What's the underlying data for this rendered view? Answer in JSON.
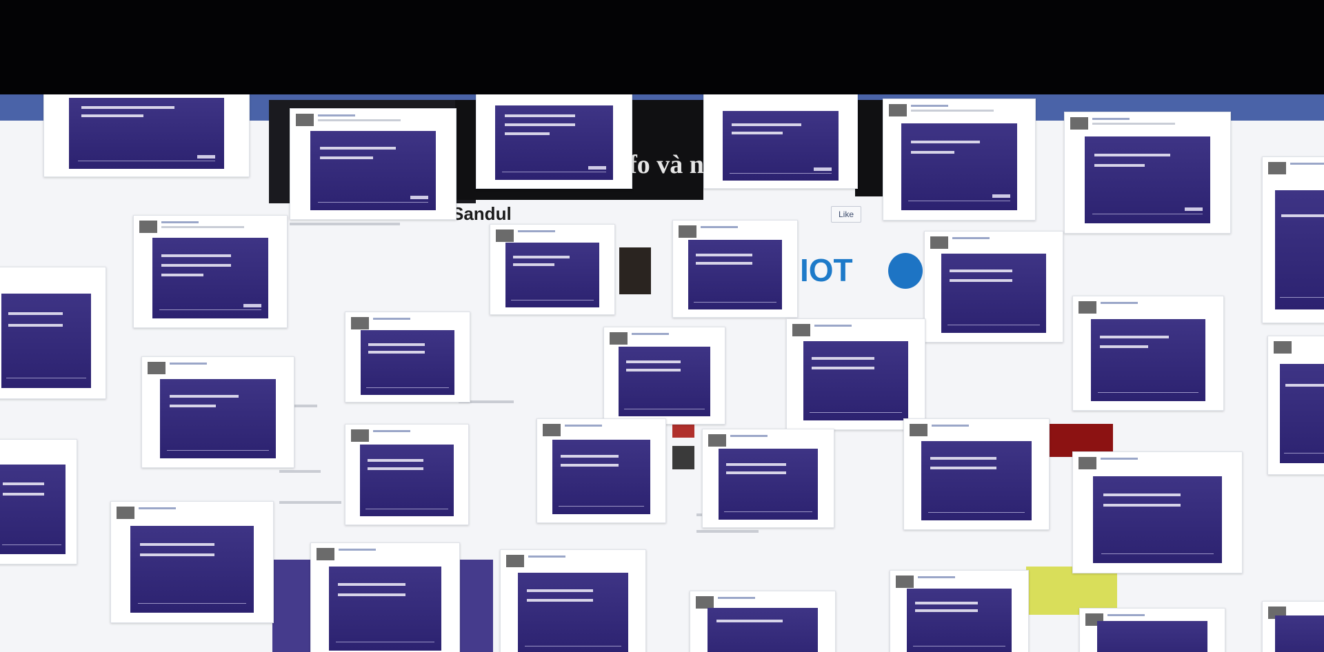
{
  "topbar": {
    "color": "#030305"
  },
  "fb_header": {
    "brand": "",
    "color": "#4a63a8"
  },
  "background_texts": {
    "slogan_fragment": "nfo và n",
    "headline_fragment": "Sandul",
    "brand_fragment": "IOT",
    "like_button": "Like"
  },
  "card_gradient": [
    "#3e3485",
    "#2c2270"
  ],
  "post_count": 37
}
